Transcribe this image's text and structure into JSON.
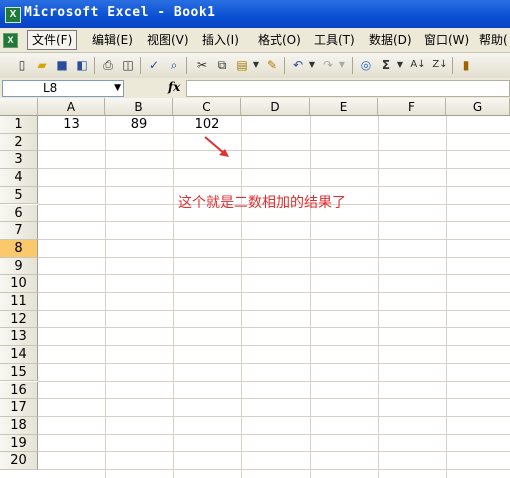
{
  "window": {
    "title": "Microsoft Excel - Book1",
    "app_icon": "X"
  },
  "menubar": {
    "items": [
      {
        "label": "文件(F)"
      },
      {
        "label": "编辑(E)"
      },
      {
        "label": "视图(V)"
      },
      {
        "label": "插入(I)"
      },
      {
        "label": "格式(O)"
      },
      {
        "label": "工具(T)"
      },
      {
        "label": "数据(D)"
      },
      {
        "label": "窗口(W)"
      },
      {
        "label": "帮助("
      }
    ]
  },
  "formula_bar": {
    "name_box": "L8",
    "fx_label": "fx",
    "formula": ""
  },
  "columns": [
    "A",
    "B",
    "C",
    "D",
    "E",
    "F",
    "G"
  ],
  "rows": [
    "1",
    "2",
    "3",
    "4",
    "5",
    "6",
    "7",
    "8",
    "9",
    "10",
    "11",
    "12",
    "13",
    "14",
    "15",
    "16",
    "17",
    "18",
    "19",
    "20"
  ],
  "selected_row": "8",
  "cells": {
    "A1": "13",
    "B1": "89",
    "C1": "102"
  },
  "annotation": {
    "text": "这个就是二数相加的结果了",
    "color": "#e03030"
  }
}
